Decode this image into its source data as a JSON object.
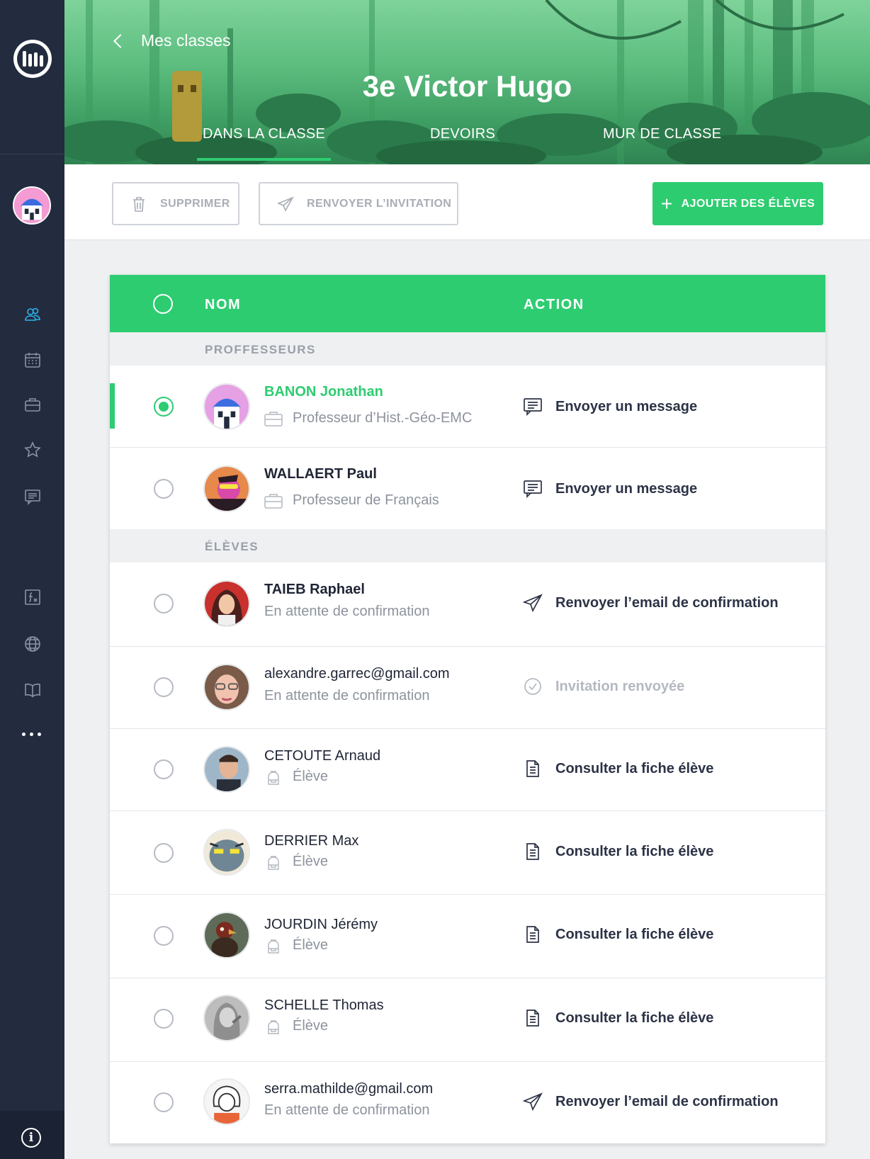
{
  "header": {
    "back_label": "Mes classes",
    "class_title": "3e Victor Hugo",
    "tabs": [
      {
        "label": "DANS LA CLASSE",
        "active": true
      },
      {
        "label": "DEVOIRS",
        "active": false
      },
      {
        "label": "MUR DE CLASSE",
        "active": false
      }
    ]
  },
  "toolbar": {
    "delete_label": "SUPPRIMER",
    "resend_label": "RENVOYER L’INVITATION",
    "add_label": "AJOUTER DES ÉLÈVES"
  },
  "table": {
    "col_name": "NOM",
    "col_action": "ACTION",
    "section_teachers": "PROFFESSEURS",
    "section_students": "ÉLÈVES",
    "teachers": [
      {
        "name": "BANON Jonathan",
        "role": "Professeur d’Hist.-Géo-EMC",
        "action": "Envoyer un message",
        "selected": true
      },
      {
        "name": "WALLAERT Paul",
        "role": "Professeur de Français",
        "action": "Envoyer un message",
        "selected": false
      }
    ],
    "students": [
      {
        "name": "TAIEB Raphael",
        "status": "En attente de confirmation",
        "action": "Renvoyer l’email de confirmation"
      },
      {
        "name": "alexandre.garrec@gmail.com",
        "status": "En attente de confirmation",
        "action": "Invitation renvoyée"
      },
      {
        "name": "CETOUTE Arnaud",
        "status": "Élève",
        "action": "Consulter la fiche élève"
      },
      {
        "name": "DERRIER Max",
        "status": "Élève",
        "action": "Consulter la fiche élève"
      },
      {
        "name": "JOURDIN Jérémy",
        "status": "Élève",
        "action": "Consulter la fiche élève"
      },
      {
        "name": "SCHELLE Thomas",
        "status": "Élève",
        "action": "Consulter la fiche élève"
      },
      {
        "name": "serra.mathilde@gmail.com",
        "status": "En attente de confirmation",
        "action": "Renvoyer l’email de confirmation"
      }
    ]
  },
  "colors": {
    "accent": "#2ecc71",
    "sidebar": "#232b3e",
    "sidebar_active_icon": "#2ab6f0"
  },
  "sidebar_icons": [
    "users-icon",
    "calendar-icon",
    "briefcase-icon",
    "star-icon",
    "messages-icon",
    "formula-icon",
    "globe-icon",
    "book-icon",
    "more-icon",
    "info-icon"
  ]
}
